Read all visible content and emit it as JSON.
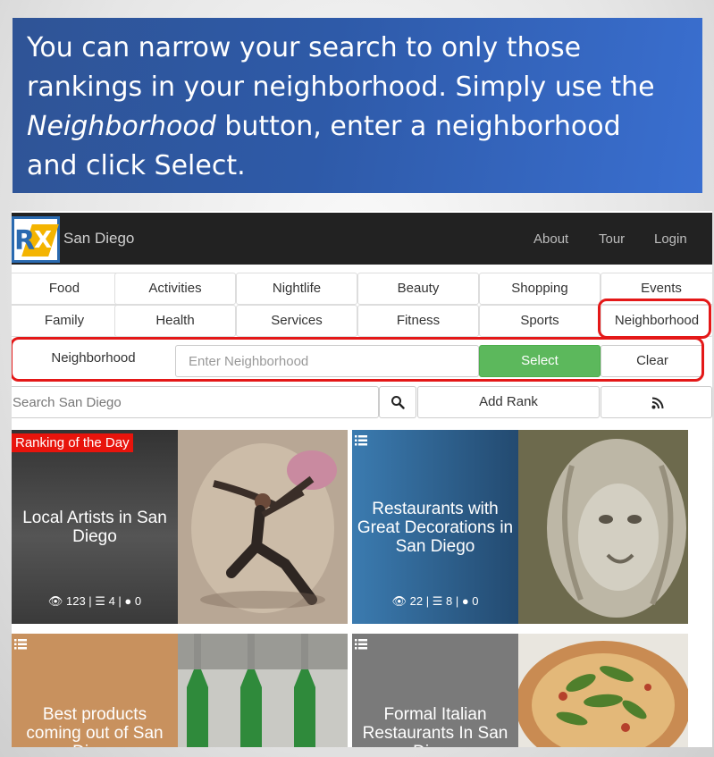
{
  "banner": {
    "line1": "You can narrow your search to only those",
    "line2": "rankings in your neighborhood. Simply use the",
    "line3_em": "Neighborhood",
    "line3_rest": " button, enter a neighborhood",
    "line4": "and click Select."
  },
  "header": {
    "city": "San Diego",
    "nav": [
      "About",
      "Tour",
      "Login"
    ]
  },
  "categories": {
    "row1": [
      "Food",
      "Activities",
      "Nightlife",
      "Beauty",
      "Shopping",
      "Events"
    ],
    "row2": [
      "Family",
      "Health",
      "Services",
      "Fitness",
      "Sports",
      "Neighborhood"
    ]
  },
  "neighborhood": {
    "label": "Neighborhood",
    "placeholder": "Enter Neighborhood",
    "select_label": "Select",
    "clear_label": "Clear"
  },
  "search": {
    "placeholder": "Search San Diego",
    "add_label": "Add Rank"
  },
  "cards": [
    {
      "badge": "Ranking of the Day",
      "title": "Local Artists in San Diego",
      "views": "123",
      "lists": "4",
      "comments": "0",
      "color": "#333333"
    },
    {
      "title": "Restaurants with Great Decorations in San Diego",
      "views": "22",
      "lists": "8",
      "comments": "0",
      "color": "#2f6ea0"
    },
    {
      "title": "Best products coming out of San Diego",
      "color": "#c8915e"
    },
    {
      "title": "Formal Italian Restaurants In San Diego",
      "color": "#7a7a7a"
    }
  ],
  "colors": {
    "banner": "#2f5496",
    "highlight": "#e41818",
    "select": "#5cb85c",
    "topbar": "#222222"
  }
}
